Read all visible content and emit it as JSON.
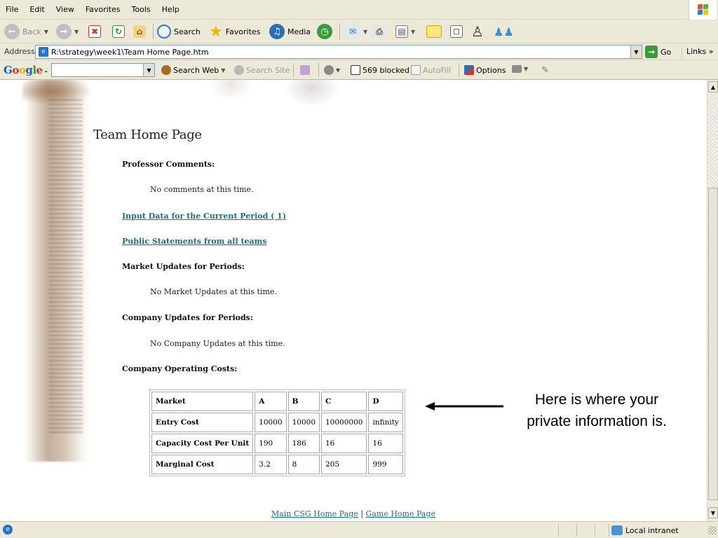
{
  "menubar": {
    "items": [
      "File",
      "Edit",
      "View",
      "Favorites",
      "Tools",
      "Help"
    ]
  },
  "toolbar": {
    "back_label": "Back",
    "search_label": "Search",
    "favorites_label": "Favorites",
    "media_label": "Media"
  },
  "address": {
    "label": "Address",
    "value": "R:\\strategy\\week1\\Team Home Page.htm",
    "go_label": "Go",
    "links_label": "Links »"
  },
  "google": {
    "logo": "Google -",
    "search_web_label": "Search Web",
    "search_site_label": "Search Site",
    "blocked_label": "569 blocked",
    "autofill_label": "AutoFill",
    "options_label": "Options"
  },
  "page": {
    "title": "Team Home Page",
    "professor_heading": "Professor Comments:",
    "professor_text": "No comments at this time.",
    "input_link": "Input Data for the Current Period ( 1)",
    "statements_link": "Public Statements from all teams",
    "market_heading": "Market Updates for Periods:",
    "market_text": "No Market Updates at this time.",
    "company_heading": "Company Updates for Periods:",
    "company_text": "No Company Updates at this time.",
    "costs_heading": "Company Operating Costs:",
    "table": {
      "header": [
        "Market",
        "A",
        "B",
        "C",
        "D"
      ],
      "rows": [
        [
          "Entry Cost",
          "10000",
          "10000",
          "10000000",
          "infinity"
        ],
        [
          "Capacity Cost Per Unit",
          "190",
          "186",
          "16",
          "16"
        ],
        [
          "Marginal Cost",
          "3.2",
          "8",
          "205",
          "999"
        ]
      ]
    },
    "annotation_line1": "Here is where your",
    "annotation_line2": "private information is.",
    "footer_link1": "Main CSG Home Page",
    "footer_sep": " | ",
    "footer_link2": "Game Home Page"
  },
  "status": {
    "zone_label": "Local intranet"
  },
  "colors": {
    "chrome": "#ece9d8",
    "link": "#1f6f7f"
  }
}
